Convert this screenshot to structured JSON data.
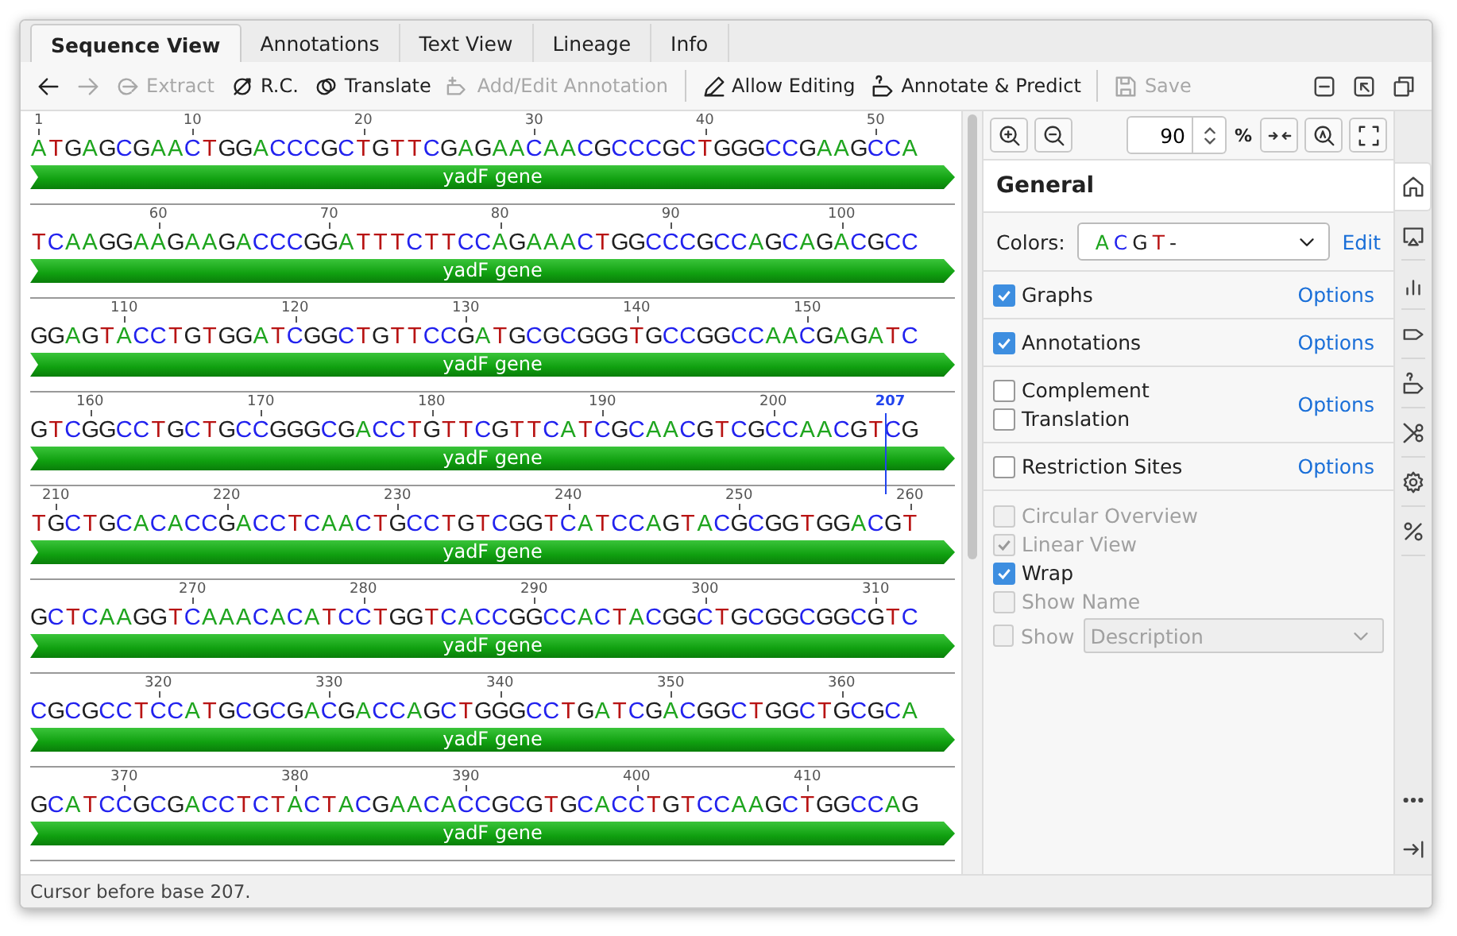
{
  "tabs": [
    {
      "label": "Sequence View",
      "selected": true
    },
    {
      "label": "Annotations",
      "selected": false
    },
    {
      "label": "Text View",
      "selected": false
    },
    {
      "label": "Lineage",
      "selected": false
    },
    {
      "label": "Info",
      "selected": false
    }
  ],
  "toolbar": {
    "groups": [
      [
        {
          "kind": "back",
          "disabled": false
        },
        {
          "kind": "forward",
          "disabled": true
        },
        {
          "kind": "extract",
          "label": "Extract",
          "disabled": true
        },
        {
          "kind": "reverse-complement",
          "label": "R.C.",
          "disabled": false
        },
        {
          "kind": "translate",
          "label": "Translate",
          "disabled": false
        },
        {
          "kind": "annotation",
          "label": "Add/Edit Annotation",
          "disabled": true
        }
      ],
      [
        {
          "kind": "edit",
          "label": "Allow Editing",
          "disabled": false
        },
        {
          "kind": "predict",
          "label": "Annotate & Predict",
          "disabled": false
        }
      ],
      [
        {
          "kind": "save",
          "label": "Save",
          "disabled": true
        }
      ]
    ]
  },
  "sequence": {
    "cursor": "207",
    "rows": [
      {
        "bases": "ATGAGCGAACTGGACCCGCTGTTCGAGAACAACGCCCGCTGGGCCGAAGCCA",
        "ticks": [
          "1",
          "10",
          "20",
          "30",
          "40",
          "50"
        ],
        "annotation": "yadF gene"
      },
      {
        "bases": "TCAAGGAAGAAGACCCGGATTTCTTCCAGAAACTGGCCCGCCAGCAGACGCC",
        "ticks": [
          "60",
          "70",
          "80",
          "90",
          "100"
        ],
        "annotation": "yadF gene"
      },
      {
        "bases": "GGAGTACCTGTGGATCGGCTGTTCCGATGCGCGGGTGCCGGCCAACGAGATC",
        "ticks": [
          "110",
          "120",
          "130",
          "140",
          "150"
        ],
        "annotation": "yadF gene"
      },
      {
        "bases": "GTCGGCCTGCTGCCGGGCGACCTGTTCGTTCATCGCAACGTCGCCAACGTCG",
        "ticks": [
          "160",
          "170",
          "180",
          "190",
          "200"
        ],
        "annotation": "yadF gene"
      },
      {
        "bases": "TGCTGCACACCGACCTCAACTGCCTGTCGGTCATCCAGTACGCGGTGGACGT",
        "ticks": [
          "210",
          "220",
          "230",
          "240",
          "250",
          "260"
        ],
        "annotation": "yadF gene"
      },
      {
        "bases": "GCTCAAGGTCAAACACATCCTGGTCACCGGCCACTACGGCTGCGGCGGCGTC",
        "ticks": [
          "270",
          "280",
          "290",
          "300",
          "310"
        ],
        "annotation": "yadF gene"
      },
      {
        "bases": "CGCGCCTCCATGCGCGACGACCAGCTGGGCCTGATCGACGGCTGGCTGCGCA",
        "ticks": [
          "320",
          "330",
          "340",
          "350",
          "360"
        ],
        "annotation": "yadF gene"
      },
      {
        "bases": "GCATCCGCGACCTCTACTACGAACACCGCGTGCACCTGTCCAAGCTGGCCAG",
        "ticks": [
          "370",
          "380",
          "390",
          "400",
          "410"
        ],
        "annotation": "yadF gene"
      }
    ]
  },
  "panel": {
    "zoom": {
      "value": "90",
      "unit": "%"
    },
    "title": "General",
    "colors": {
      "label": "Colors:",
      "scheme": [
        {
          "symbol": "A",
          "color": "#1fa51f"
        },
        {
          "symbol": "C",
          "color": "#2222ee"
        },
        {
          "symbol": "G",
          "color": "#202020"
        },
        {
          "symbol": "T",
          "color": "#b81414"
        },
        {
          "symbol": "-",
          "color": "#202020"
        }
      ],
      "link": "Edit"
    },
    "groups": [
      {
        "items": [
          {
            "label": "Graphs",
            "checked": true
          }
        ],
        "link": "Options"
      },
      {
        "items": [
          {
            "label": "Annotations",
            "checked": true
          }
        ],
        "link": "Options"
      },
      {
        "items": [
          {
            "label": "Complement",
            "checked": false
          },
          {
            "label": "Translation",
            "checked": false
          }
        ],
        "link": "Options"
      },
      {
        "items": [
          {
            "label": "Restriction Sites",
            "checked": false
          }
        ],
        "link": "Options"
      }
    ],
    "view_options": [
      {
        "label": "Circular Overview",
        "checked": false,
        "disabled": true
      },
      {
        "label": "Linear View",
        "checked": true,
        "disabled": true
      },
      {
        "label": "Wrap",
        "checked": true,
        "disabled": false
      },
      {
        "label": "Show Name",
        "checked": false,
        "disabled": true
      },
      {
        "label": "Show",
        "checked": false,
        "disabled": true,
        "dropdown": "Description"
      }
    ]
  },
  "side_tabs": [
    {
      "kind": "home",
      "selected": true
    },
    {
      "kind": "display",
      "selected": false
    },
    {
      "kind": "graph",
      "selected": false
    },
    {
      "kind": "annotation",
      "selected": false
    },
    {
      "kind": "predict",
      "selected": false
    },
    {
      "kind": "cut",
      "selected": false
    },
    {
      "kind": "settings",
      "selected": false
    },
    {
      "kind": "percent",
      "selected": false
    }
  ],
  "status_bar": "Cursor before base 207."
}
